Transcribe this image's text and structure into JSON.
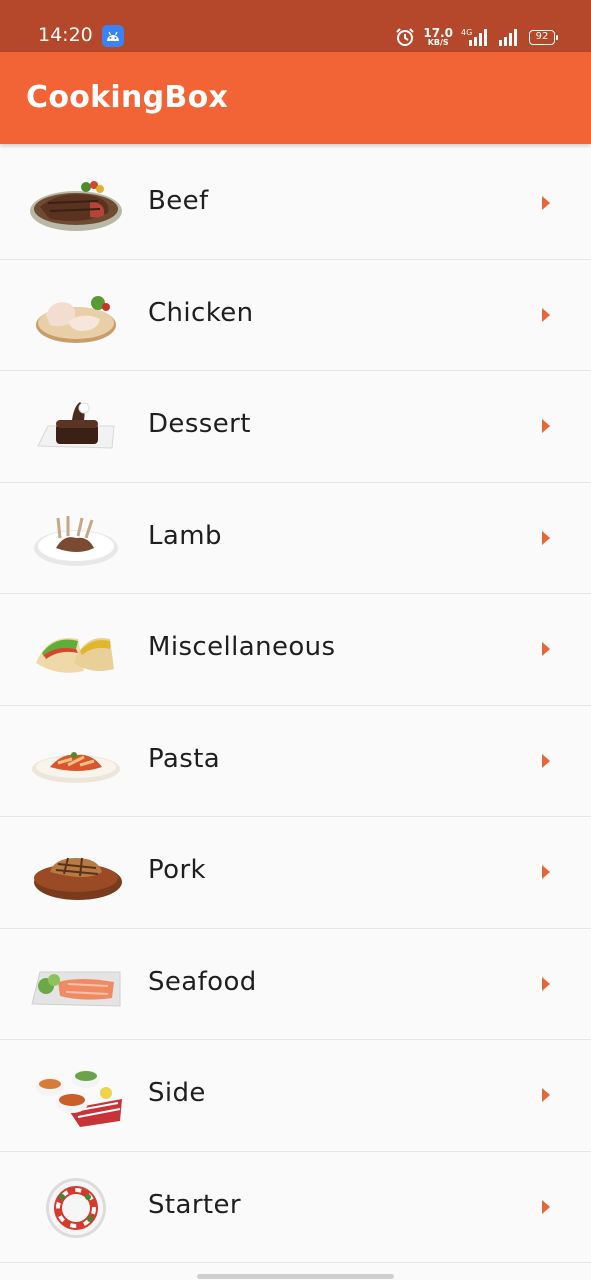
{
  "status_bar": {
    "time": "14:20",
    "net_speed_value": "17.0",
    "net_speed_unit": "KB/S",
    "network_type": "4G",
    "battery": "92"
  },
  "app_bar": {
    "title": "CookingBox"
  },
  "colors": {
    "status_bar": "#b5472b",
    "app_bar": "#f26436",
    "chevron": "#e8643a",
    "background": "#fafafa"
  },
  "categories": [
    {
      "label": "Beef",
      "icon": "beef-steak-image"
    },
    {
      "label": "Chicken",
      "icon": "chicken-image"
    },
    {
      "label": "Dessert",
      "icon": "dessert-cake-image"
    },
    {
      "label": "Lamb",
      "icon": "lamb-chops-image"
    },
    {
      "label": "Miscellaneous",
      "icon": "tacos-image"
    },
    {
      "label": "Pasta",
      "icon": "pasta-image"
    },
    {
      "label": "Pork",
      "icon": "pork-image"
    },
    {
      "label": "Seafood",
      "icon": "seafood-salmon-image"
    },
    {
      "label": "Side",
      "icon": "side-dishes-image"
    },
    {
      "label": "Starter",
      "icon": "starter-salad-image"
    }
  ]
}
